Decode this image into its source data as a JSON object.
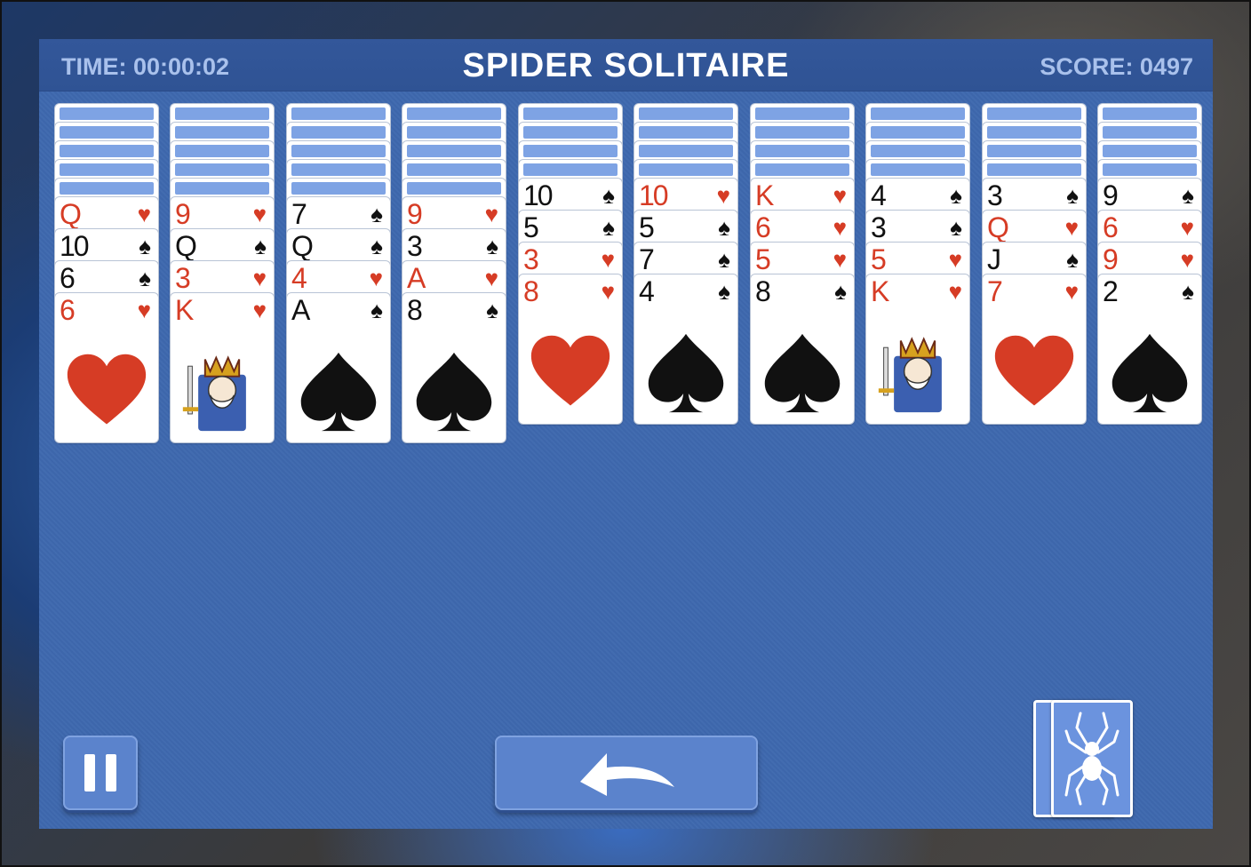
{
  "header": {
    "time_label": "TIME: 00:00:02",
    "title": "SPIDER SOLITAIRE",
    "score_label": "SCORE: 0497"
  },
  "colors": {
    "table": "#3e68ae",
    "red_suit": "#d63c25",
    "black_suit": "#111111",
    "card_back": "#7ea3e4",
    "button": "#5b83cc"
  },
  "tableau": [
    {
      "face_down": 5,
      "cards": [
        [
          "Q",
          "hearts"
        ],
        [
          "10",
          "spades"
        ],
        [
          "6",
          "spades"
        ],
        [
          "6",
          "hearts"
        ]
      ]
    },
    {
      "face_down": 5,
      "cards": [
        [
          "9",
          "hearts"
        ],
        [
          "Q",
          "spades"
        ],
        [
          "3",
          "hearts"
        ],
        [
          "K",
          "hearts"
        ]
      ]
    },
    {
      "face_down": 5,
      "cards": [
        [
          "7",
          "spades"
        ],
        [
          "Q",
          "spades"
        ],
        [
          "4",
          "hearts"
        ],
        [
          "A",
          "spades"
        ]
      ]
    },
    {
      "face_down": 5,
      "cards": [
        [
          "9",
          "hearts"
        ],
        [
          "3",
          "spades"
        ],
        [
          "A",
          "hearts"
        ],
        [
          "8",
          "spades"
        ]
      ]
    },
    {
      "face_down": 4,
      "cards": [
        [
          "10",
          "spades"
        ],
        [
          "5",
          "spades"
        ],
        [
          "3",
          "hearts"
        ],
        [
          "8",
          "hearts"
        ]
      ]
    },
    {
      "face_down": 4,
      "cards": [
        [
          "10",
          "hearts"
        ],
        [
          "5",
          "spades"
        ],
        [
          "7",
          "spades"
        ],
        [
          "4",
          "spades"
        ]
      ]
    },
    {
      "face_down": 4,
      "cards": [
        [
          "K",
          "hearts"
        ],
        [
          "6",
          "hearts"
        ],
        [
          "5",
          "hearts"
        ],
        [
          "8",
          "spades"
        ]
      ]
    },
    {
      "face_down": 4,
      "cards": [
        [
          "4",
          "spades"
        ],
        [
          "3",
          "spades"
        ],
        [
          "5",
          "hearts"
        ],
        [
          "K",
          "hearts"
        ]
      ]
    },
    {
      "face_down": 4,
      "cards": [
        [
          "3",
          "spades"
        ],
        [
          "Q",
          "hearts"
        ],
        [
          "J",
          "spades"
        ],
        [
          "7",
          "hearts"
        ]
      ]
    },
    {
      "face_down": 4,
      "cards": [
        [
          "9",
          "spades"
        ],
        [
          "6",
          "hearts"
        ],
        [
          "9",
          "hearts"
        ],
        [
          "2",
          "spades"
        ]
      ]
    }
  ],
  "controls": {
    "pause_icon": "pause-icon",
    "undo_icon": "undo-arrow-icon",
    "stock_icon": "spider-icon",
    "stock_piles": 2
  }
}
